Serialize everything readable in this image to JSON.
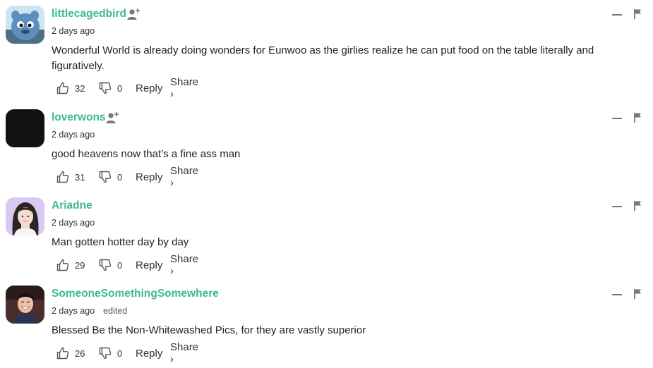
{
  "comments": [
    {
      "username": "littlecagedbird",
      "time": "2 days ago",
      "edited": "",
      "text": "Wonderful World is already doing wonders for Eunwoo as the girlies realize he can put food on the table literally and figuratively.",
      "likes": "32",
      "dislikes": "0",
      "show_follow": true,
      "avatar_bg": "#7fb0d6"
    },
    {
      "username": "loverwons",
      "time": "2 days ago",
      "edited": "",
      "text": "good heavens now that’s a fine ass man",
      "likes": "31",
      "dislikes": "0",
      "show_follow": true,
      "avatar_bg": "#111111"
    },
    {
      "username": "Ariadne",
      "time": "2 days ago",
      "edited": "",
      "text": "Man gotten hotter day by day",
      "likes": "29",
      "dislikes": "0",
      "show_follow": false,
      "avatar_bg": "#c9b6e8"
    },
    {
      "username": "SomeoneSomethingSomewhere",
      "time": "2 days ago",
      "edited": "edited",
      "text": "Blessed Be the Non-Whitewashed Pics, for they are vastly superior",
      "likes": "26",
      "dislikes": "0",
      "show_follow": false,
      "avatar_bg": "#3a2a2a"
    }
  ],
  "labels": {
    "reply": "Reply",
    "share": "Share ›"
  },
  "colors": {
    "username": "#3db98f",
    "icon_gray": "#777777"
  }
}
